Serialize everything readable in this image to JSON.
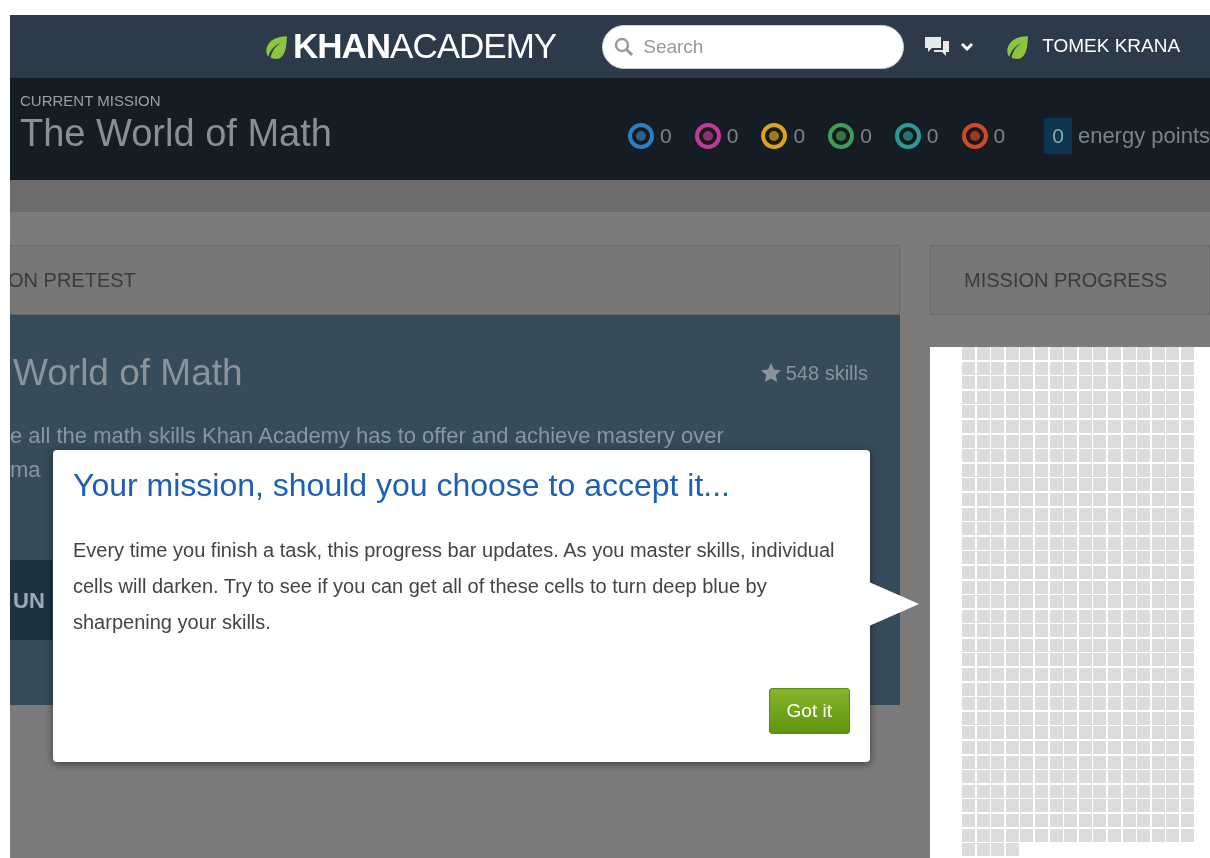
{
  "navbar": {
    "logo_bold": "KHAN",
    "logo_light": "ACADEMY",
    "search": {
      "placeholder": "Search"
    },
    "user_name": "TOMEK KRANA"
  },
  "mission_header": {
    "label": "CURRENT MISSION",
    "title": "The World of Math",
    "badges": [
      {
        "color": "#2a7fc4",
        "count": "0"
      },
      {
        "color": "#c0399a",
        "count": "0"
      },
      {
        "color": "#d9a520",
        "count": "0"
      },
      {
        "color": "#3f9c5a",
        "count": "0"
      },
      {
        "color": "#2a9a9a",
        "count": "0"
      },
      {
        "color": "#d04a2a",
        "count": "0"
      }
    ],
    "energy_points": {
      "value": "0",
      "label": "energy points"
    }
  },
  "pretest_panel": {
    "header": "ON PRETEST",
    "title": "World of Math",
    "skills": "548 skills",
    "description_lines": [
      "e all the math skills Khan Academy has to offer and achieve mastery over",
      "ma"
    ],
    "button": "UN"
  },
  "progress_panel": {
    "header": "MISSION PROGRESS"
  },
  "tooltip": {
    "title": "Your mission, should you choose to accept it...",
    "body": "Every time you finish a task, this progress bar updates. As you master skills, individual cells will darken. Try to see if you can get all of these cells to turn deep blue by sharpening your skills.",
    "button": "Got it"
  }
}
